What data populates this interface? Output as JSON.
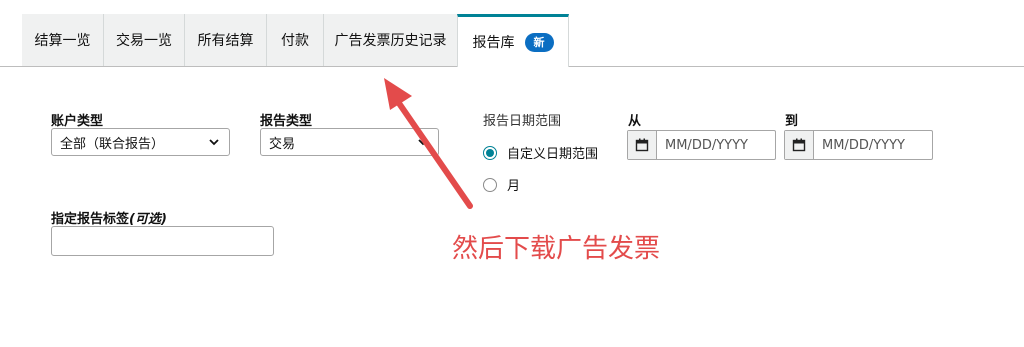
{
  "tabs": [
    {
      "label": "结算一览"
    },
    {
      "label": "交易一览"
    },
    {
      "label": "所有结算"
    },
    {
      "label": "付款"
    },
    {
      "label": "广告发票历史记录"
    },
    {
      "label": "报告库",
      "badge": "新"
    }
  ],
  "form": {
    "account_type": {
      "label": "账户类型",
      "value": "全部（联合报告）"
    },
    "report_type": {
      "label": "报告类型",
      "value": "交易"
    },
    "date_range": {
      "label": "报告日期范围",
      "options": [
        {
          "label": "自定义日期范围",
          "checked": true
        },
        {
          "label": "月",
          "checked": false
        }
      ]
    },
    "from": {
      "label": "从",
      "placeholder": "MM/DD/YYYY"
    },
    "to": {
      "label": "到",
      "placeholder": "MM/DD/YYYY"
    },
    "report_tag": {
      "label": "指定报告标签",
      "optional": "(可选)",
      "value": ""
    }
  },
  "annotation": {
    "text": "然后下载广告发票",
    "color": "#e34b4b"
  },
  "colors": {
    "accent": "#008296",
    "badge": "#0b6ec2",
    "tab_bg": "#f0f1f1"
  }
}
